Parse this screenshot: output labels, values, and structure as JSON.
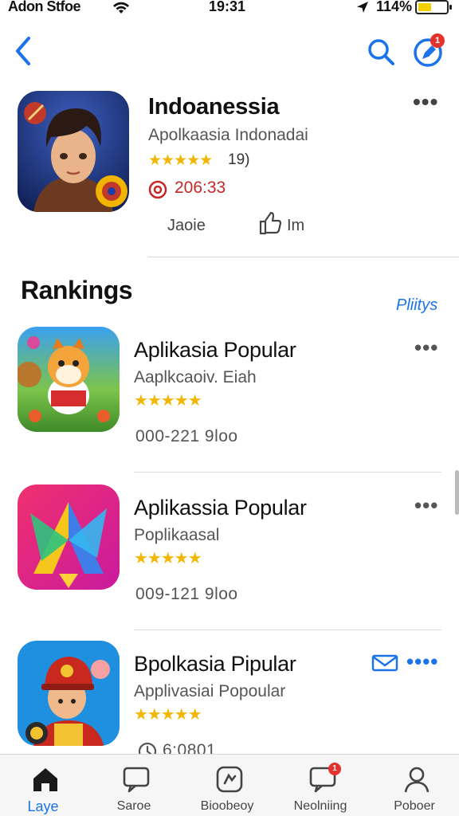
{
  "status_bar": {
    "carrier": "Adon Stfoe",
    "time": "19:31",
    "battery": "114%"
  },
  "nav": {
    "back_icon": "chevron-left-icon",
    "search_icon": "search-icon",
    "profile_icon": "edit-icon",
    "profile_badge": "1"
  },
  "featured": {
    "title": "Indoanessia",
    "subtitle": "Apolkaasia Indonadai",
    "stars": "★★★★★",
    "rating_count": "19)",
    "downloads": "206:33",
    "share_label": "Jaoie",
    "like_label": "Im",
    "more": "•••"
  },
  "rankings": {
    "title": "Rankings",
    "link": "Pliitys",
    "items": [
      {
        "title": "Aplikasia Popular",
        "subtitle": "Aaplkcaoiv. Eiah",
        "stars": "★★★★★",
        "meta": "000-221  9loo",
        "more": "•••"
      },
      {
        "title": "Aplikassia Popular",
        "subtitle": "Poplikaasal",
        "stars": "★★★★★",
        "meta": "009-121  9loo",
        "more": "•••"
      },
      {
        "title": "Bpolkasia Pipular",
        "subtitle": "Applivasiai Popoular",
        "stars": "★★★★★",
        "meta": "6:0801",
        "more": "••••"
      }
    ]
  },
  "tabbar": {
    "tabs": [
      {
        "label": "Laye",
        "icon": "home-icon",
        "active": true
      },
      {
        "label": "Saroe",
        "icon": "chat-icon",
        "active": false
      },
      {
        "label": "Bioobeoy",
        "icon": "games-icon",
        "active": false
      },
      {
        "label": "Neolniing",
        "icon": "notification-icon",
        "badge": "1",
        "active": false
      },
      {
        "label": "Poboer",
        "icon": "person-icon",
        "active": false
      }
    ]
  },
  "colors": {
    "accent": "#1a73e8",
    "star": "#f2b705",
    "downloads": "#c62828",
    "badge": "#e5322d"
  }
}
